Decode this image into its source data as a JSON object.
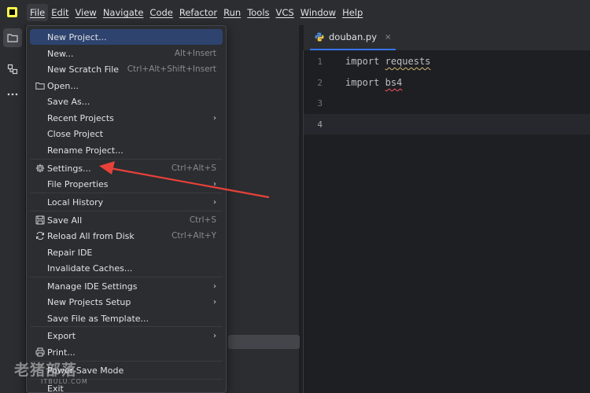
{
  "menubar": {
    "items": [
      "File",
      "Edit",
      "View",
      "Navigate",
      "Code",
      "Refactor",
      "Run",
      "Tools",
      "VCS",
      "Window",
      "Help"
    ]
  },
  "toolstrip": {
    "icons": [
      "folder-icon",
      "structure-icon",
      "more-icon"
    ]
  },
  "editor": {
    "tab": {
      "label": "douban.py",
      "close": "×"
    },
    "lines": [
      {
        "no": "1",
        "kw": "import",
        "module": "requests"
      },
      {
        "no": "2",
        "kw": "import",
        "module": "bs4"
      },
      {
        "no": "3",
        "kw": "",
        "module": ""
      },
      {
        "no": "4",
        "kw": "",
        "module": ""
      }
    ]
  },
  "file_menu": {
    "items": [
      {
        "label": "New Project...",
        "shortcut": "",
        "submenu": false
      },
      {
        "label": "New...",
        "shortcut": "Alt+Insert",
        "submenu": false
      },
      {
        "label": "New Scratch File",
        "shortcut": "Ctrl+Alt+Shift+Insert",
        "submenu": false
      },
      {
        "label": "Open...",
        "shortcut": "",
        "submenu": false,
        "icon": "folder-icon"
      },
      {
        "label": "Save As...",
        "shortcut": "",
        "submenu": false
      },
      {
        "label": "Recent Projects",
        "shortcut": "",
        "submenu": true
      },
      {
        "label": "Close Project",
        "shortcut": "",
        "submenu": false
      },
      {
        "label": "Rename Project...",
        "shortcut": "",
        "submenu": false
      },
      {
        "label": "Settings...",
        "shortcut": "Ctrl+Alt+S",
        "submenu": false,
        "icon": "gear-icon"
      },
      {
        "label": "File Properties",
        "shortcut": "",
        "submenu": true
      },
      {
        "label": "Local History",
        "shortcut": "",
        "submenu": true
      },
      {
        "label": "Save All",
        "shortcut": "Ctrl+S",
        "submenu": false,
        "icon": "save-icon"
      },
      {
        "label": "Reload All from Disk",
        "shortcut": "Ctrl+Alt+Y",
        "submenu": false,
        "icon": "reload-icon"
      },
      {
        "label": "Repair IDE",
        "shortcut": "",
        "submenu": false
      },
      {
        "label": "Invalidate Caches...",
        "shortcut": "",
        "submenu": false
      },
      {
        "label": "Manage IDE Settings",
        "shortcut": "",
        "submenu": true
      },
      {
        "label": "New Projects Setup",
        "shortcut": "",
        "submenu": true
      },
      {
        "label": "Save File as Template...",
        "shortcut": "",
        "submenu": false
      },
      {
        "label": "Export",
        "shortcut": "",
        "submenu": true
      },
      {
        "label": "Print...",
        "shortcut": "",
        "submenu": false,
        "icon": "print-icon"
      },
      {
        "label": "Power Save Mode",
        "shortcut": "",
        "submenu": false
      },
      {
        "label": "Exit",
        "shortcut": "",
        "submenu": false
      }
    ]
  },
  "watermark": {
    "big": "老猪部落",
    "small": "ITBULU.COM"
  },
  "colors": {
    "accent": "#3574f0",
    "highlight": "#2e436e",
    "annotation": "#e8413a"
  }
}
